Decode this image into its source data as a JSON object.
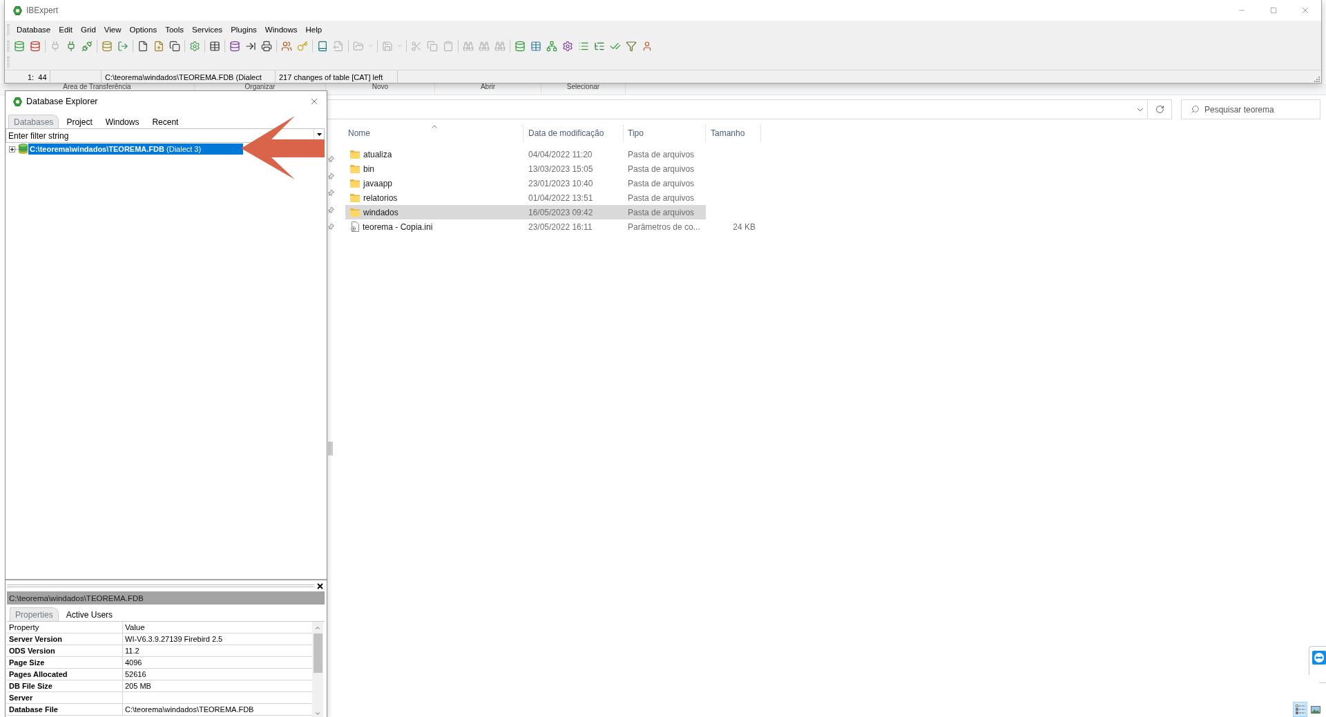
{
  "ibexpert": {
    "title": "IBExpert",
    "menu": [
      "Database",
      "Edit",
      "Grid",
      "View",
      "Options",
      "Tools",
      "Services",
      "Plugins",
      "Windows",
      "Help"
    ],
    "toolbar": [
      [
        {
          "kind": "dbadd",
          "disabled": false
        },
        {
          "kind": "dbremove",
          "disabled": false
        }
      ],
      [
        {
          "kind": "plug",
          "disabled": true
        },
        {
          "kind": "plug",
          "disabled": false
        },
        {
          "kind": "unplug",
          "disabled": false
        }
      ],
      [
        {
          "kind": "dbnew",
          "disabled": false
        },
        {
          "kind": "exit",
          "disabled": false
        }
      ],
      [
        {
          "kind": "page",
          "disabled": false
        },
        {
          "kind": "pagenew",
          "disabled": false
        },
        {
          "kind": "windows",
          "disabled": false
        }
      ],
      [
        {
          "kind": "gear",
          "disabled": false
        }
      ],
      [
        {
          "kind": "grid",
          "disabled": false
        }
      ],
      [
        {
          "kind": "dbquery",
          "disabled": false
        },
        {
          "kind": "forward",
          "disabled": false
        },
        {
          "kind": "printer",
          "disabled": false
        }
      ],
      [
        {
          "kind": "users",
          "disabled": false
        },
        {
          "kind": "key",
          "disabled": false
        }
      ],
      [
        {
          "kind": "book",
          "disabled": false
        },
        {
          "kind": "export",
          "disabled": true
        }
      ],
      [
        {
          "kind": "folder",
          "disabled": true
        },
        {
          "kind": "caret",
          "disabled": true
        }
      ],
      [
        {
          "kind": "save",
          "disabled": true
        },
        {
          "kind": "caret",
          "disabled": true
        }
      ],
      [
        {
          "kind": "cut",
          "disabled": true
        },
        {
          "kind": "copy",
          "disabled": true
        },
        {
          "kind": "paste",
          "disabled": true
        }
      ],
      [
        {
          "kind": "find",
          "disabled": true
        },
        {
          "kind": "find",
          "disabled": true
        },
        {
          "kind": "find",
          "disabled": true
        }
      ],
      [
        {
          "kind": "database",
          "disabled": false
        },
        {
          "kind": "table",
          "disabled": false
        },
        {
          "kind": "tree",
          "disabled": false
        },
        {
          "kind": "cog",
          "disabled": false
        },
        {
          "kind": "list",
          "disabled": false
        },
        {
          "kind": "listtree",
          "disabled": false
        },
        {
          "kind": "check",
          "disabled": false
        },
        {
          "kind": "filter",
          "disabled": false
        },
        {
          "kind": "user",
          "disabled": false
        }
      ]
    ],
    "status_bar": [
      "1:  44",
      "C:\\teorema\\windados\\TEOREMA.FDB (Dialect",
      "217 changes of table [CAT] left"
    ]
  },
  "explorer": {
    "ribbon_groups": [
      "Área de Transferência",
      "Organizar",
      "Novo",
      "Abrir",
      "Selecionar"
    ],
    "search": {
      "placeholder": "Pesquisar teorema"
    },
    "columns": [
      {
        "label": "Nome",
        "sorted": true
      },
      {
        "label": "Data de modificação",
        "sorted": false
      },
      {
        "label": "Tipo",
        "sorted": false
      },
      {
        "label": "Tamanho",
        "sorted": false
      }
    ],
    "rows": [
      {
        "kind": "folder",
        "name": "atualiza",
        "modified": "04/04/2022 11:20",
        "type": "Pasta de arquivos",
        "selected": false
      },
      {
        "kind": "folder",
        "name": "bin",
        "modified": "13/03/2023 15:05",
        "type": "Pasta de arquivos",
        "selected": false
      },
      {
        "kind": "folder",
        "name": "javaapp",
        "modified": "23/01/2023 10:40",
        "type": "Pasta de arquivos",
        "selected": false
      },
      {
        "kind": "folder",
        "name": "relatorios",
        "modified": "01/04/2022 13:51",
        "type": "Pasta de arquivos",
        "selected": false
      },
      {
        "kind": "folder",
        "name": "windados",
        "modified": "16/05/2023 09:42",
        "type": "Pasta de arquivos",
        "selected": true
      },
      {
        "kind": "file",
        "name": "teorema - Copia.ini",
        "modified": "23/05/2022 16:11",
        "type": "Parâmetros de co...",
        "size": "24 KB",
        "selected": false
      }
    ],
    "view_modes": [
      {
        "kind": "details",
        "selected": true
      },
      {
        "kind": "thumbnails",
        "selected": false
      }
    ]
  },
  "database_explorer": {
    "title": "Database Explorer",
    "tabs": [
      {
        "label": "Databases",
        "selected": true
      },
      {
        "label": "Project",
        "selected": false
      },
      {
        "label": "Windows",
        "selected": false
      },
      {
        "label": "Recent",
        "selected": false
      }
    ],
    "filter": {
      "placeholder": "Enter filter string"
    },
    "tree": [
      {
        "label": "**C:\\teorema\\windados\\TEOREMA.FDB** (Dialect 3)",
        "expanded": false,
        "selected": true
      }
    ],
    "details": {
      "path": "C:\\teorema\\windados\\TEOREMA.FDB",
      "tabs": [
        {
          "label": "Properties",
          "selected": true
        },
        {
          "label": "Active Users",
          "selected": false
        }
      ],
      "columns": [
        "Property",
        "Value"
      ],
      "rows": [
        {
          "property": "Server Version",
          "value": "WI-V6.3.9.27139 Firebird 2.5"
        },
        {
          "property": "ODS Version",
          "value": "11.2"
        },
        {
          "property": "Page Size",
          "value": "4096"
        },
        {
          "property": "Pages Allocated",
          "value": "52616"
        },
        {
          "property": "DB File Size",
          "value": "205 MB"
        },
        {
          "property": "Server"
        },
        {
          "property": "Database File",
          "value": "C:\\teorema\\windados\\TEOREMA.FDB"
        }
      ]
    }
  }
}
